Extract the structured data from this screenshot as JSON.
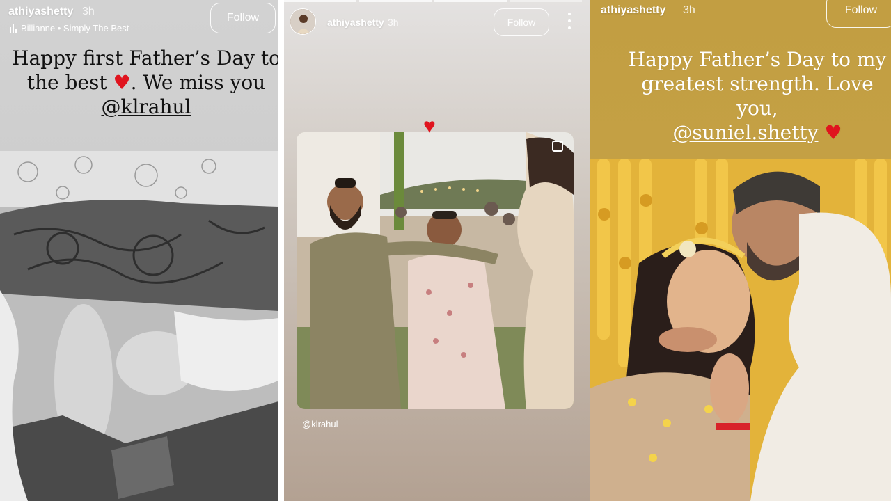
{
  "story1": {
    "username": "athiyashetty",
    "time": "3h",
    "follow_label": "Follow",
    "music": "Billianne • Simply The Best",
    "caption_line1": "Happy first Father’s Day to",
    "caption_line2_pre": "the best",
    "caption_line2_post": ". We miss you",
    "heart": "♥",
    "mention": "@klrahul"
  },
  "story2": {
    "username": "athiyashetty",
    "time": "3h",
    "follow_label": "Follow",
    "heart": "♥",
    "mention_sticker": "@klrahul"
  },
  "story3": {
    "username": "athiyashetty",
    "time": "3h",
    "follow_label": "Follow",
    "caption_line1": "Happy Father’s Day to my",
    "caption_line2": "greatest strength. Love you,",
    "mention": "@suniel.shetty",
    "heart": "♥"
  },
  "colors": {
    "heart": "#e0141e",
    "story3_background": "#c29e42"
  }
}
